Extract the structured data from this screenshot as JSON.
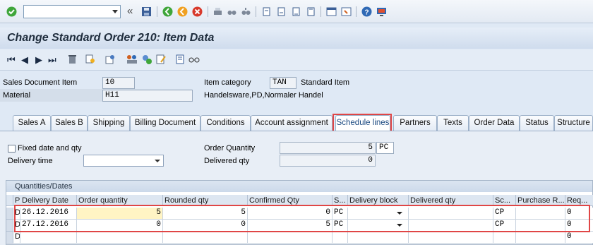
{
  "toolbar": {
    "command_field": {
      "value": "",
      "placeholder": ""
    },
    "icons": [
      "enter-icon",
      "back-arrows-icon",
      "save-icon",
      "back-icon",
      "exit-icon",
      "cancel-icon",
      "print-icon",
      "find-icon",
      "find-next-icon",
      "first-page-icon",
      "prev-page-icon",
      "next-page-icon",
      "last-page-icon",
      "new-session-icon",
      "shortcut-icon",
      "layout-icon",
      "help-icon",
      "customize-icon"
    ],
    "back_glyph": "«"
  },
  "page_title": "Change Standard Order 210: Item Data",
  "app_toolbar": {
    "icons": [
      "first-item-icon",
      "prev-item-icon",
      "next-item-icon",
      "last-item-icon",
      "delete-icon",
      "display-doc-flow-icon",
      "status-overview-icon",
      "partner-icon",
      "config-icon",
      "notes-icon",
      "glasses-icon"
    ]
  },
  "header": {
    "sales_doc_item_label": "Sales Document Item",
    "sales_doc_item_value": "10",
    "material_label": "Material",
    "material_value": "H11",
    "item_category_label": "Item category",
    "item_category_value": "TAN",
    "item_category_text": "Standard Item",
    "material_description": "Handelsware,PD,Normaler Handel"
  },
  "tabs": [
    {
      "label": "Sales A",
      "active": false
    },
    {
      "label": "Sales B",
      "active": false
    },
    {
      "label": "Shipping",
      "active": false
    },
    {
      "label": "Billing Document",
      "active": false
    },
    {
      "label": "Conditions",
      "active": false
    },
    {
      "label": "Account assignment",
      "active": false
    },
    {
      "label": "Schedule lines",
      "active": true
    },
    {
      "label": "Partners",
      "active": false
    },
    {
      "label": "Texts",
      "active": false
    },
    {
      "label": "Order Data",
      "active": false
    },
    {
      "label": "Status",
      "active": false
    },
    {
      "label": "Structure",
      "active": false
    }
  ],
  "panel": {
    "fixed_date_label": "Fixed date and qty",
    "fixed_date_checked": false,
    "delivery_time_label": "Delivery time",
    "delivery_time_value": "",
    "order_quantity_label": "Order Quantity",
    "order_quantity_value": "5",
    "order_quantity_unit": "PC",
    "delivered_qty_label": "Delivered qty",
    "delivered_qty_value": "0"
  },
  "grid": {
    "title": "Quantities/Dates",
    "columns": [
      "P",
      "Delivery Date",
      "Order quantity",
      "Rounded qty",
      "Confirmed Qty",
      "S...",
      "Delivery block",
      "Delivered qty",
      "Sc...",
      "Purchase R...",
      "Req..."
    ],
    "rows": [
      {
        "p": "D",
        "date": "26.12.2016",
        "order_qty": "5",
        "rounded": "5",
        "confirmed": "0",
        "su": "PC",
        "block": "",
        "delivered": "",
        "sc": "CP",
        "purchase": "",
        "req": "0"
      },
      {
        "p": "D",
        "date": "27.12.2016",
        "order_qty": "0",
        "rounded": "0",
        "confirmed": "5",
        "su": "PC",
        "block": "",
        "delivered": "",
        "sc": "CP",
        "purchase": "",
        "req": "0"
      },
      {
        "p": "D",
        "date": "",
        "order_qty": "",
        "rounded": "",
        "confirmed": "",
        "su": "",
        "block": "",
        "delivered": "",
        "sc": "",
        "purchase": "",
        "req": "0"
      }
    ]
  },
  "colors": {
    "highlight": "#e04646",
    "active_tab_text": "#1d4b82",
    "yellow_cell": "#fff4c4"
  }
}
